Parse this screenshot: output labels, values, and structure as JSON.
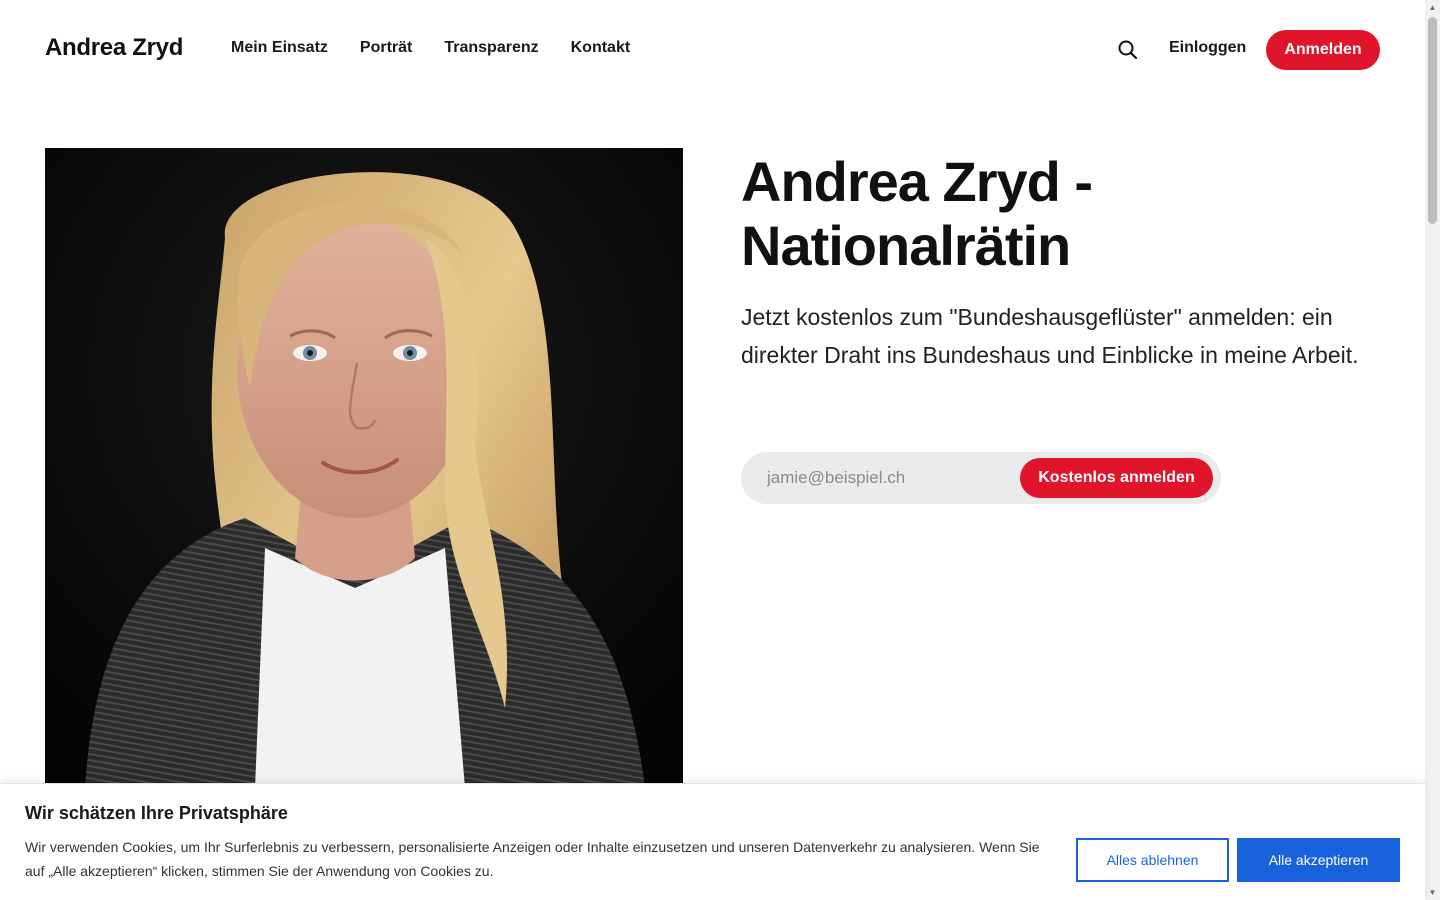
{
  "header": {
    "brand": "Andrea Zryd",
    "nav": [
      "Mein Einsatz",
      "Porträt",
      "Transparenz",
      "Kontakt"
    ],
    "login_label": "Einloggen",
    "signup_label": "Anmelden",
    "search_icon": "search-icon"
  },
  "hero": {
    "title": "Andrea Zryd - Nationalrätin",
    "subtitle": "Jetzt kostenlos zum \"Bundeshausgeflüster\" anmelden: ein direkter Draht ins Bundeshaus und Einblicke in meine Arbeit.",
    "email_placeholder": "jamie@beispiel.ch",
    "email_value": "",
    "submit_label": "Kostenlos anmelden",
    "photo": "portrait-photo"
  },
  "cookie": {
    "title": "Wir schätzen Ihre Privatsphäre",
    "text": "Wir verwenden Cookies, um Ihr Surferlebnis zu verbessern, personalisierte Anzeigen oder Inhalte einzusetzen und unseren Datenverkehr zu analysieren. Wenn Sie auf „Alle akzeptieren“ klicken, stimmen Sie der Anwendung von Cookies zu.",
    "reject_label": "Alles ablehnen",
    "accept_label": "Alle akzeptieren"
  },
  "colors": {
    "accent": "#e0142a",
    "cookie_blue": "#1863dc",
    "input_bg": "#ebebeb"
  }
}
